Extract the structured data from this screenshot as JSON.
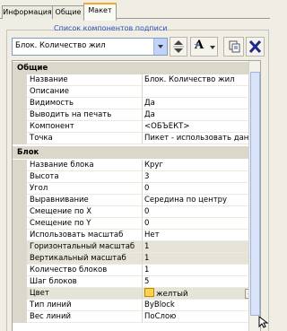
{
  "tabs": [
    "Информация",
    "Общие",
    "Макет"
  ],
  "active_tab": "Макет",
  "caption": "Список компонентов подписи",
  "combo": {
    "value": "Блок. Количество жил"
  },
  "toolbar": {
    "font_button": "A"
  },
  "groups": [
    {
      "title": "Общие",
      "rows": [
        {
          "name": "Название",
          "value": "Блок. Количество жил"
        },
        {
          "name": "Описание",
          "value": ""
        },
        {
          "name": "Видимость",
          "value": "Да"
        },
        {
          "name": "Выводить на печать",
          "value": "Да"
        },
        {
          "name": "Компонент",
          "value": "<ОБЪЕКТ>"
        },
        {
          "name": "Точка",
          "value": "Пикет - использовать данные"
        }
      ]
    },
    {
      "title": "Блок",
      "rows": [
        {
          "name": "Название блока",
          "value": "Круг"
        },
        {
          "name": "Высота",
          "value": "3"
        },
        {
          "name": "Угол",
          "value": "0"
        },
        {
          "name": "Выравнивание",
          "value": "Середина по центру"
        },
        {
          "name": "Смещение по X",
          "value": "0"
        },
        {
          "name": "Смещение по Y",
          "value": "0"
        },
        {
          "name": "Использовать масштаб",
          "value": "Нет"
        },
        {
          "name": "Горизонтальный масштаб",
          "value": "1"
        },
        {
          "name": "Вертикальный масштаб",
          "value": "1"
        },
        {
          "name": "Количество блоков",
          "value": "1"
        },
        {
          "name": "Шаг блоков",
          "value": "5"
        },
        {
          "name": "Цвет",
          "value": "желтый"
        },
        {
          "name": "Тип линий",
          "value": "ByBlock"
        },
        {
          "name": "Вес линий",
          "value": "ПоСлою"
        }
      ]
    }
  ],
  "colors": {
    "accent_tab": "#f4a830",
    "caption": "#2a52be",
    "swatch": "#ffd24c",
    "delete": "#1e2a8a"
  }
}
